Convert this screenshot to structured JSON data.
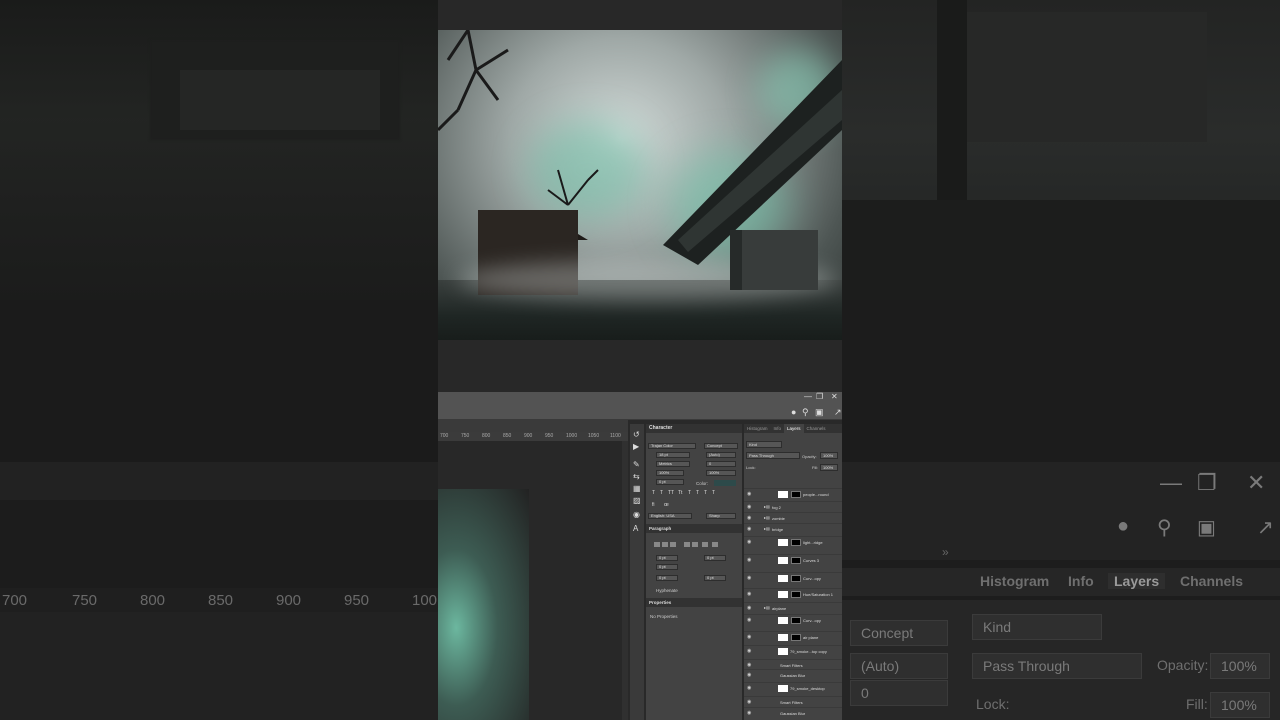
{
  "background_left": {
    "ruler_ticks": [
      "700",
      "750",
      "800",
      "850",
      "900",
      "950",
      "100"
    ]
  },
  "background_right": {
    "tabs": [
      "Histogram",
      "Info",
      "Layers",
      "Channels"
    ],
    "active_tab": "Layers",
    "font_style": "Concept",
    "leading": "(Auto)",
    "tracking": "0",
    "kind_filter": "Kind",
    "blend_mode": "Pass Through",
    "opacity_label": "Opacity:",
    "opacity_value": "100%",
    "lock_label": "Lock:",
    "fill_label": "Fill:",
    "fill_value": "100%",
    "scale_value": "100%"
  },
  "ps": {
    "ruler": [
      "700",
      "750",
      "800",
      "850",
      "900",
      "950",
      "1000",
      "1050",
      "1100"
    ],
    "character_panel": {
      "title": "Character",
      "font_family": "Trajan Color",
      "font_style": "Concept",
      "font_size": "18 pt",
      "leading": "(Auto)",
      "kerning": "Metrics",
      "tracking": "0",
      "vertical_scale": "100%",
      "horizontal_scale": "100%",
      "baseline": "0 pt",
      "color_label": "Color:",
      "language": "English: USA",
      "antialias": "Sharp"
    },
    "paragraph_panel": {
      "title": "Paragraph",
      "indent_left": "0 pt",
      "indent_right": "0 pt",
      "indent_first": "0 pt",
      "space_before": "0 pt",
      "space_after": "0 pt",
      "hyphenate": "Hyphenate"
    },
    "properties_panel": {
      "title": "Properties",
      "empty_text": "No Properties"
    },
    "layers_panel": {
      "tabs": [
        "Histogram",
        "Info",
        "Layers",
        "Channels"
      ],
      "active_tab": "Layers",
      "kind_filter": "Kind",
      "blend_mode": "Pass Through",
      "opacity_label": "Opacity:",
      "opacity_value": "100%",
      "lock_label": "Lock:",
      "fill_label": "Fill:",
      "fill_value": "100%",
      "layers": [
        {
          "name": "people...round",
          "type": "layer"
        },
        {
          "name": "fog 2",
          "type": "group"
        },
        {
          "name": "zombie",
          "type": "group"
        },
        {
          "name": "bridge",
          "type": "group"
        },
        {
          "name": "light...ridge",
          "type": "adjust"
        },
        {
          "name": "Curves 3",
          "type": "adjust"
        },
        {
          "name": "Curv...opy",
          "type": "adjust"
        },
        {
          "name": "Hue/Saturation 1",
          "type": "adjust"
        },
        {
          "name": "airplane",
          "type": "group"
        },
        {
          "name": "Curv...opy",
          "type": "adjust"
        },
        {
          "name": "air plane",
          "type": "layer"
        },
        {
          "name": "79_smoke...top copy",
          "type": "smart"
        },
        {
          "name": "Smart Filters",
          "type": "filter"
        },
        {
          "name": "Gaussian Blur",
          "type": "filter"
        },
        {
          "name": "79_smoke_desktop",
          "type": "smart"
        },
        {
          "name": "Smart Filters",
          "type": "filter"
        },
        {
          "name": "Gaussian Blur",
          "type": "filter"
        }
      ]
    }
  }
}
